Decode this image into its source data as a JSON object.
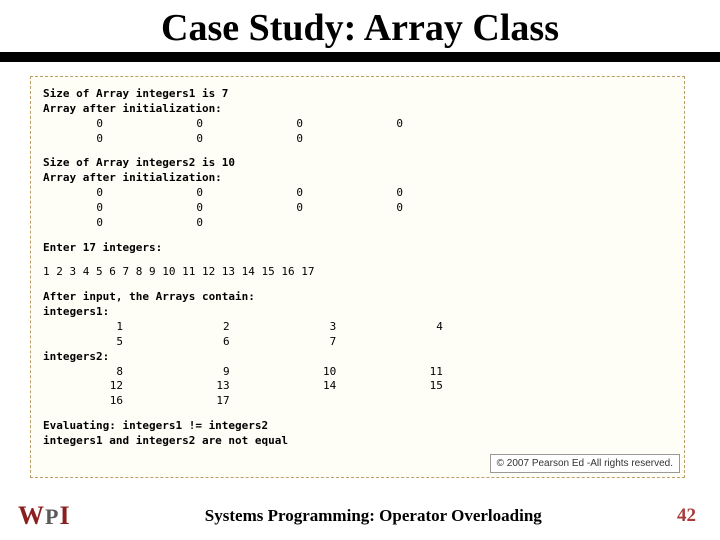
{
  "title": "Case Study: Array Class",
  "code": {
    "size1": "Size of Array integers1 is 7",
    "afterInit": "Array after initialization:",
    "row1a": [
      "0",
      "0",
      "0",
      "0"
    ],
    "row1b": [
      "0",
      "0",
      "0"
    ],
    "size2": "Size of Array integers2 is 10",
    "row2a": [
      "0",
      "0",
      "0",
      "0"
    ],
    "row2b": [
      "0",
      "0",
      "0",
      "0"
    ],
    "row2c": [
      "0",
      "0"
    ],
    "enter": "Enter 17 integers:",
    "input": "1 2 3 4 5 6 7 8 9 10 11 12 13 14 15 16 17",
    "afterInput": "After input, the Arrays contain:",
    "lbl1": "integers1:",
    "i1a": [
      "1",
      "2",
      "3",
      "4"
    ],
    "i1b": [
      "5",
      "6",
      "7"
    ],
    "lbl2": "integers2:",
    "i2a": [
      "8",
      "9",
      "10",
      "11"
    ],
    "i2b": [
      "12",
      "13",
      "14",
      "15"
    ],
    "i2c": [
      "16",
      "17"
    ],
    "eval": "Evaluating: integers1 != integers2",
    "noteq": "integers1 and integers2 are not equal"
  },
  "copyright": "© 2007 Pearson Ed -All rights reserved.",
  "logo": {
    "w": "W",
    "p": "P",
    "i": "I"
  },
  "footer": "Systems Programming:  Operator Overloading",
  "page": "42"
}
